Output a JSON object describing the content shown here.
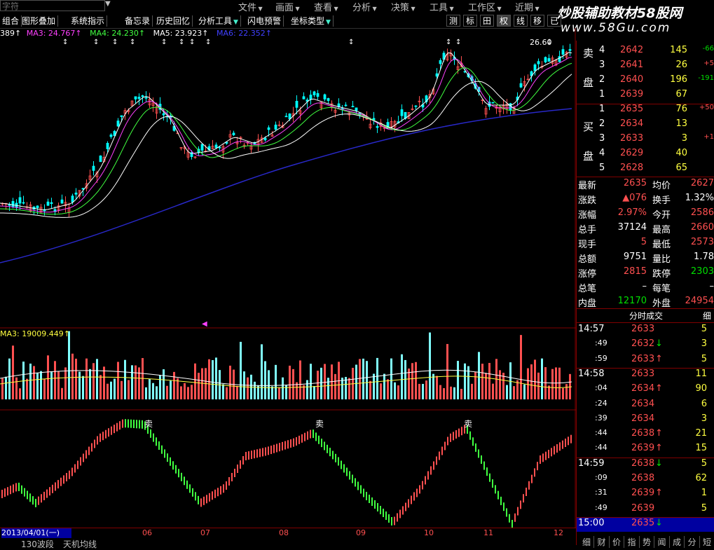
{
  "menu": {
    "search_text": "字符",
    "items": [
      "文件",
      "画面",
      "查看",
      "分析",
      "决策",
      "工具",
      "工作区",
      "近期"
    ]
  },
  "toolbar": {
    "items": [
      "组合",
      "图形叠加",
      "系统指示",
      "备忘录",
      "历史回忆",
      "分析工具",
      "闪电预警",
      "坐标类型"
    ],
    "right_buttons": [
      "测",
      "标",
      "田",
      "权",
      "线",
      "移",
      "已"
    ]
  },
  "watermark": {
    "line1": "炒股辅助教材58股网",
    "line2": "www.58Gu.com"
  },
  "ma_line": {
    "prefix": "389↑",
    "ma3": "MA3: 24.767↑",
    "ma4": "MA4: 24.230↑",
    "ma5": "MA5: 23.923↑",
    "ma6": "MA6: 22.352↑"
  },
  "price_marker": "26.60",
  "volume_label": "MA3: 19009.449↑",
  "sell_signal": "卖",
  "date_axis": {
    "current": "2013/04/01(一)",
    "months": [
      "06",
      "07",
      "08",
      "09",
      "10",
      "11",
      "12"
    ]
  },
  "bottom_tabs": {
    "items": [
      "130波段",
      "天机均线"
    ]
  },
  "order_book": {
    "sell_label": [
      "卖",
      "盘"
    ],
    "buy_label": [
      "买",
      "盘"
    ],
    "asks": [
      {
        "level": "4",
        "price": "2642",
        "vol": "145",
        "chg": "-66"
      },
      {
        "level": "3",
        "price": "2641",
        "vol": "26",
        "chg": "+5"
      },
      {
        "level": "2",
        "price": "2640",
        "vol": "196",
        "chg": "-191"
      },
      {
        "level": "1",
        "price": "2639",
        "vol": "67",
        "chg": ""
      }
    ],
    "bids": [
      {
        "level": "1",
        "price": "2635",
        "vol": "76",
        "chg": "+50"
      },
      {
        "level": "2",
        "price": "2634",
        "vol": "13",
        "chg": ""
      },
      {
        "level": "3",
        "price": "2633",
        "vol": "3",
        "chg": "+1"
      },
      {
        "level": "4",
        "price": "2629",
        "vol": "40",
        "chg": ""
      },
      {
        "level": "5",
        "price": "2628",
        "vol": "65",
        "chg": ""
      }
    ]
  },
  "quote": [
    {
      "l": "最新",
      "v": "2635",
      "vc": "red",
      "l2": "均价",
      "v2": "2627",
      "v2c": "red"
    },
    {
      "l": "涨跌",
      "v": "▲076",
      "vc": "red",
      "l2": "换手",
      "v2": "1.32%",
      "v2c": "white"
    },
    {
      "l": "涨幅",
      "v": "2.97%",
      "vc": "red",
      "l2": "今开",
      "v2": "2586",
      "v2c": "red"
    },
    {
      "l": "总手",
      "v": "37124",
      "vc": "white",
      "l2": "最高",
      "v2": "2660",
      "v2c": "red"
    },
    {
      "l": "现手",
      "v": "5",
      "vc": "red",
      "l2": "最低",
      "v2": "2573",
      "v2c": "red"
    },
    {
      "l": "总额",
      "v": "9751",
      "vc": "white",
      "l2": "量比",
      "v2": "1.78",
      "v2c": "white"
    },
    {
      "l": "涨停",
      "v": "2815",
      "vc": "red",
      "l2": "跌停",
      "v2": "2303",
      "v2c": "green"
    },
    {
      "l": "总笔",
      "v": "–",
      "vc": "white",
      "l2": "每笔",
      "v2": "–",
      "v2c": "white"
    },
    {
      "l": "内盘",
      "v": "12170",
      "vc": "green",
      "l2": "外盘",
      "v2": "24954",
      "v2c": "red"
    }
  ],
  "trades_header": "分时成交",
  "trades_tab": "细",
  "trades": [
    {
      "t": "14:57",
      "p": "2633",
      "arrow": "",
      "v": "5",
      "major": true
    },
    {
      "t": ":49",
      "p": "2632",
      "arrow": "down",
      "v": "3",
      "major": false
    },
    {
      "t": ":59",
      "p": "2633",
      "arrow": "up",
      "v": "5",
      "major": false
    },
    {
      "t": "14:58",
      "p": "2633",
      "arrow": "",
      "v": "11",
      "major": true
    },
    {
      "t": ":04",
      "p": "2634",
      "arrow": "up",
      "v": "90",
      "major": false
    },
    {
      "t": ":24",
      "p": "2634",
      "arrow": "",
      "v": "6",
      "major": false
    },
    {
      "t": ":39",
      "p": "2634",
      "arrow": "",
      "v": "3",
      "major": false
    },
    {
      "t": ":44",
      "p": "2638",
      "arrow": "up",
      "v": "21",
      "major": false
    },
    {
      "t": ":44",
      "p": "2639",
      "arrow": "up",
      "v": "15",
      "major": false
    },
    {
      "t": "14:59",
      "p": "2638",
      "arrow": "down",
      "v": "5",
      "major": true
    },
    {
      "t": ":09",
      "p": "2638",
      "arrow": "",
      "v": "62",
      "major": false
    },
    {
      "t": ":31",
      "p": "2639",
      "arrow": "up",
      "v": "1",
      "major": false
    },
    {
      "t": ":49",
      "p": "2639",
      "arrow": "",
      "v": "5",
      "major": false
    },
    {
      "t": "15:00",
      "p": "2635",
      "arrow": "down",
      "v": "",
      "major": true
    }
  ],
  "right_bottom_tabs": [
    "细",
    "财",
    "价",
    "指",
    "势",
    "闻",
    "成",
    "分",
    "短"
  ],
  "colors": {
    "up": "#ff5050",
    "down": "#00ffff",
    "vol_up": "#ff5050",
    "vol_down": "#80ffff",
    "ma_blue": "#2020c0"
  }
}
